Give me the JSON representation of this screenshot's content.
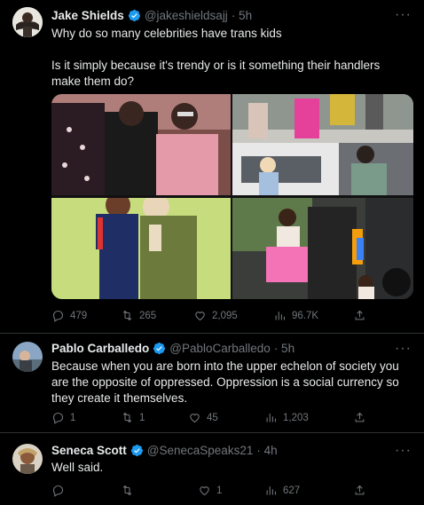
{
  "tweet1": {
    "name": "Jake Shields",
    "handle": "@jakeshieldsajj",
    "time": "· 5h",
    "text_line1": "Why do so many celebrities have trans kids",
    "text_line2": "Is it simply because it's trendy or is it something their handlers make them do?",
    "stats": {
      "replies": "479",
      "retweets": "265",
      "likes": "2,095",
      "views": "96.7K"
    }
  },
  "tweet2": {
    "name": "Pablo Carballedo",
    "handle": "@PabloCarballedo",
    "time": "· 5h",
    "text": "Because when you are born into the upper echelon of society you are the opposite of oppressed. Oppression is a social currency so they create it themselves.",
    "stats": {
      "replies": "1",
      "retweets": "1",
      "likes": "45",
      "views": "1,203"
    }
  },
  "tweet3": {
    "name": "Seneca Scott",
    "handle": "@SenecaSpeaks21",
    "time": "· 4h",
    "text": "Well said.",
    "stats": {
      "replies": "",
      "retweets": "",
      "likes": "1",
      "views": "627"
    }
  },
  "icons": {
    "reply": "reply-icon",
    "retweet": "retweet-icon",
    "like": "heart-icon",
    "views": "views-icon",
    "share": "share-icon",
    "more": "more-icon",
    "verified": "verified-badge-icon"
  },
  "colors": {
    "background": "#000000",
    "text": "#e7e9ea",
    "secondary": "#71767b",
    "verified": "#1d9bf0"
  }
}
